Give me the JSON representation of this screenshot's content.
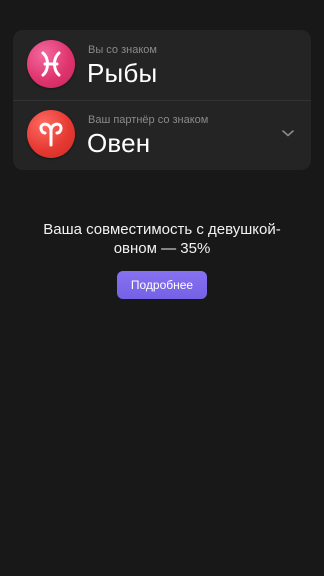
{
  "user_sign": {
    "caption": "Вы со знаком",
    "sign": "Рыбы",
    "icon": "pisces-icon",
    "color": "#e0356e"
  },
  "partner_sign": {
    "caption": "Ваш партнёр со знаком",
    "sign": "Овен",
    "icon": "aries-icon",
    "color": "#e63a33"
  },
  "result": {
    "line1": "Ваша совместимость с девушкой-",
    "line2": "овном — 35%"
  },
  "details_button": {
    "label": "Подробнее",
    "color": "#7b68ee"
  }
}
